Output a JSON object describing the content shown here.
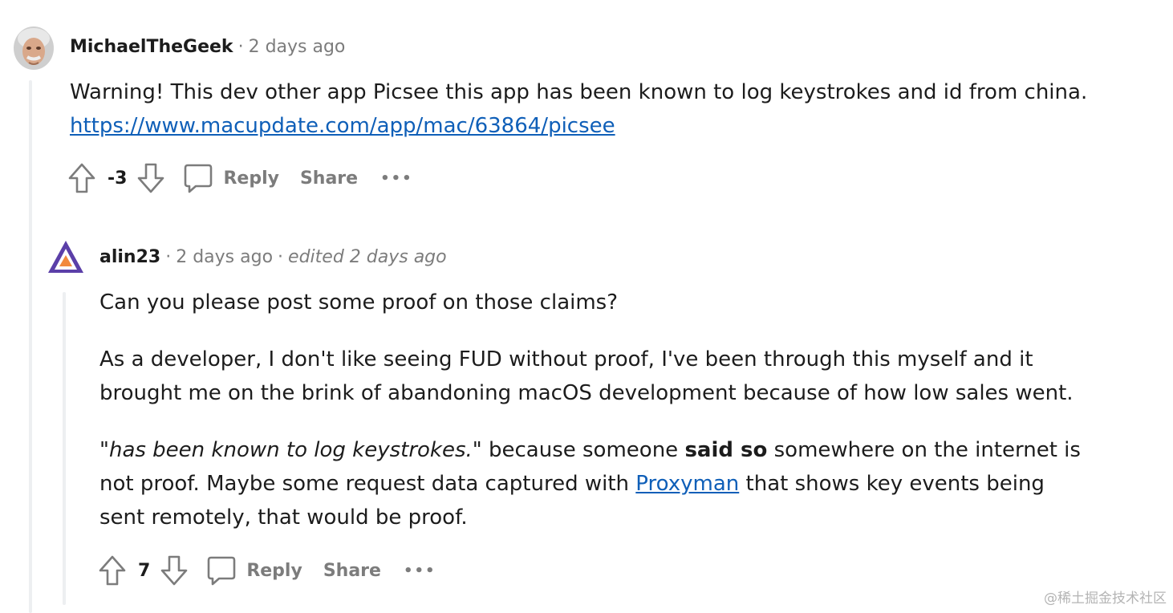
{
  "comment1": {
    "username": "MichaelTheGeek",
    "timestamp": "2 days ago",
    "text": "Warning! This dev other app Picsee this app has been known to log keystrokes and id from china.",
    "link": "https://www.macupdate.com/app/mac/63864/picsee",
    "score": "-3",
    "reply_label": "Reply",
    "share_label": "Share",
    "more_label": "•••"
  },
  "comment2": {
    "username": "alin23",
    "timestamp": "2 days ago",
    "edited": "edited 2 days ago",
    "p1": "Can you please post some proof on those claims?",
    "p2": "As a developer, I don't like seeing FUD without proof, I've been through this myself and it brought me on the brink of abandoning macOS development because of how low sales went.",
    "p3_quote": "\"has been known to log keystrokes.\"",
    "p3_a": " because someone ",
    "p3_bold": "said so",
    "p3_b": " somewhere on the internet is not proof. Maybe some request data captured with ",
    "p3_link": "Proxyman",
    "p3_c": " that shows key events being sent remotely, that would be proof.",
    "score": "7",
    "reply_label": "Reply",
    "share_label": "Share",
    "more_label": "•••"
  },
  "watermark": "@稀土掘金技术社区"
}
